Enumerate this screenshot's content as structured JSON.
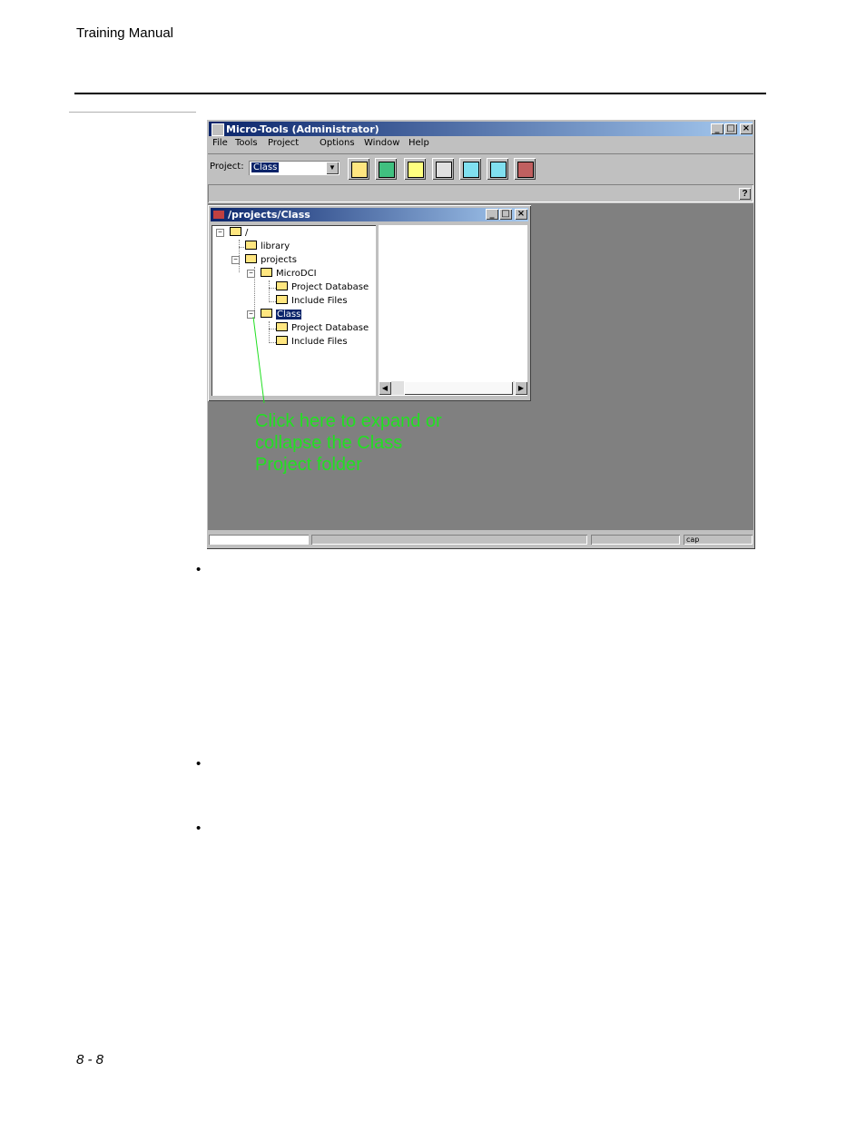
{
  "header": {
    "title": "Training Manual"
  },
  "footer": {
    "page_number": "8 - 8"
  },
  "app": {
    "title": "Micro-Tools (Administrator)",
    "menu": [
      "File",
      "Tools",
      "Project",
      "Options",
      "Window",
      "Help"
    ],
    "project_label": "Project:",
    "project_value": "Class",
    "help_button": "?",
    "status_text": "cap"
  },
  "child_window": {
    "title": "/projects/Class",
    "tree": [
      {
        "label": "/"
      },
      {
        "label": "library"
      },
      {
        "label": "projects"
      },
      {
        "label": "MicroDCI"
      },
      {
        "label": "Project Database"
      },
      {
        "label": "Include Files"
      },
      {
        "label": "Class"
      },
      {
        "label": "Project Database"
      },
      {
        "label": "Include Files"
      }
    ]
  },
  "annotation": {
    "text": "Click here to expand or collapse the Class Project folder",
    "color": "#22e022"
  },
  "bullets": [
    "•",
    "•",
    "•"
  ]
}
